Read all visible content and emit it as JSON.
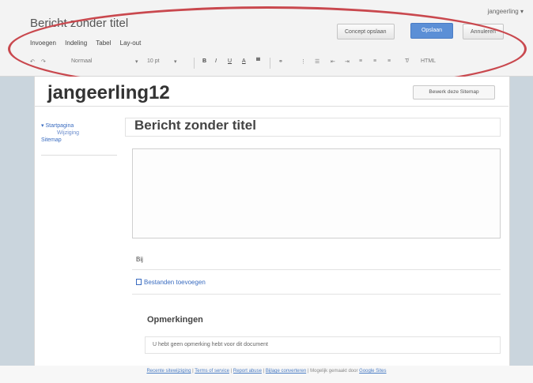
{
  "header": {
    "doc_title": "Bericht zonder titel",
    "user": "jangeerling",
    "draft_button": "Concept opslaan",
    "publish_button": "Opslaan",
    "cancel_button": "Annuleren"
  },
  "menus": [
    "Invoegen",
    "Indeling",
    "Tabel",
    "Lay-out"
  ],
  "toolbar": {
    "undo": "↶",
    "redo": "↷",
    "style_select": "Normaal",
    "font_size_select": "10 pt",
    "bold": "B",
    "italic": "I",
    "underline": "U",
    "font_color": "A",
    "highlight": "▀",
    "link": "⚭",
    "numbered_list": "⋮",
    "bullet_list": "☰",
    "outdent": "⇤",
    "indent": "⇥",
    "align_left": "≡",
    "align_center": "≡",
    "align_right": "≡",
    "clear_format": "T̸",
    "html": "HTML"
  },
  "site": {
    "title": "jangeerling12",
    "share_button": "Bewerk deze Sitemap"
  },
  "nav": {
    "items": [
      "Startpagina",
      "Wijziging",
      "Sitemap"
    ]
  },
  "post": {
    "title": "Bericht zonder titel",
    "bullet_label": "Bij",
    "attach_label": "Bestanden toevoegen"
  },
  "comments": {
    "heading": "Opmerkingen",
    "message": "U hebt geen opmerking hebt voor dit document"
  },
  "footer": {
    "links": [
      "Recente sitewijziging",
      "Terms of service",
      "Report abuse",
      "Bijlage converteren"
    ],
    "powered": "Mogelijk gemaakt door",
    "brand": "Google Sites"
  },
  "colors": {
    "annotation_oval": "#c9484e",
    "primary_button": "#5b8fd6",
    "link": "#3a6cc0",
    "side_background": "#cad5dd"
  }
}
